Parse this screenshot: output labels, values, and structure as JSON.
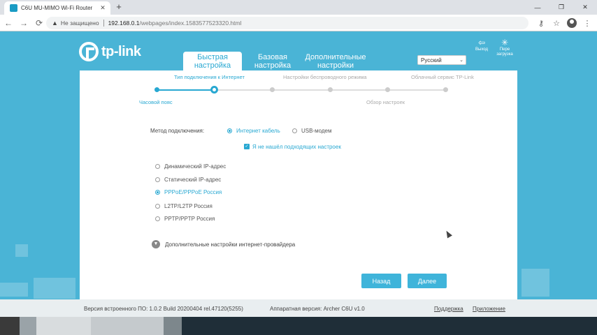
{
  "browser": {
    "tab_title": "C6U MU-MIMO Wi-Fi Router",
    "tab_close": "✕",
    "new_tab": "+",
    "minimize": "—",
    "restore": "❐",
    "close": "✕",
    "back": "←",
    "forward": "→",
    "reload": "⟳",
    "warn_icon": "▲",
    "not_secure": "Не защищено",
    "url_host": "192.168.0.1",
    "url_path": "/webpages/index.1583577523320.html",
    "key_icon": "⚷",
    "star_icon": "☆",
    "menu_icon": "⋮"
  },
  "header": {
    "logo_text": "tp-link",
    "tabs": [
      {
        "line1": "Быстрая",
        "line2": "настройка"
      },
      {
        "line1": "Базовая",
        "line2": "настройка"
      },
      {
        "line1": "Дополнительные",
        "line2": "настройки"
      }
    ],
    "language": "Русский",
    "lang_arrow": "⌄",
    "logout_icon": "⇦",
    "logout_label": "Выход",
    "reboot_icon": "✳",
    "reboot_label_1": "Пере",
    "reboot_label_2": "загрузка"
  },
  "steps": {
    "top": [
      "Тип подключения к Интернет",
      "Настройки беспроводного режима",
      "Облачный сервис TP-Link"
    ],
    "bottom": [
      "Часовой пояс",
      "Обзор настроек"
    ],
    "current_index": 1
  },
  "form": {
    "method_label": "Метод подключения:",
    "method_options": [
      "Интернет кабель",
      "USB-модем"
    ],
    "method_selected": 0,
    "checkbox_mark": "✓",
    "checkbox_label": "Я не нашёл подходящих настроек",
    "types": [
      "Динамический IP-адрес",
      "Статический IP-адрес",
      "PPPoE/PPPoE Россия",
      "L2TP/L2TP Россия",
      "PPTP/PPTP Россия"
    ],
    "type_selected": 2,
    "advanced_icon": "▼",
    "advanced_label": "Дополнительные настройки интернет-провайдера"
  },
  "buttons": {
    "back": "Назад",
    "next": "Далее"
  },
  "footer": {
    "firmware": "Версия встроенного ПО: 1.0.2 Build 20200404 rel.47120(5255)",
    "hardware": "Аппаратная версия: Archer C6U v1.0",
    "support": "Поддержка",
    "app": "Приложение"
  },
  "colors": {
    "accent": "#28a8d2",
    "background": "#4ab4d6"
  }
}
